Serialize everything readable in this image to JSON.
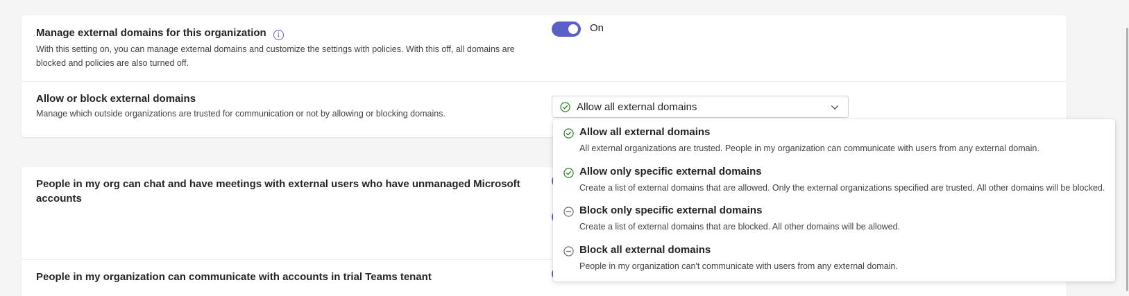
{
  "external_domains": {
    "manage_title": "Manage external domains for this organization",
    "manage_desc_line1": "With this setting on, you can manage external domains and customize the settings with policies. With this off, all domains are",
    "manage_desc_line2": "blocked and policies are also turned off.",
    "toggle_state": "On",
    "allow_block_title": "Allow or block external domains",
    "allow_block_desc": "Manage which outside organizations are trusted for communication or not by allowing or blocking domains.",
    "selected_value": "Allow all external domains"
  },
  "dropdown_options": [
    {
      "title": "Allow all external domains",
      "desc": "All external organizations are trusted. People in my organization can communicate with users from any external domain.",
      "icon": "check-circle-icon"
    },
    {
      "title": "Allow only specific external domains",
      "desc": "Create a list of external domains that are allowed. Only the external organizations specified are trusted. All other domains will be blocked.",
      "icon": "check-circle-icon"
    },
    {
      "title": "Block only specific external domains",
      "desc": "Create a list of external domains that are blocked. All other domains will be allowed.",
      "icon": "minus-circle-icon"
    },
    {
      "title": "Block all external domains",
      "desc": "People in my organization can't communicate with users from any external domain.",
      "icon": "minus-circle-icon"
    }
  ],
  "unmanaged": {
    "title_line1": "People in my org can chat and have meetings with external users who have unmanaged Microsoft",
    "title_line2": "accounts"
  },
  "trial": {
    "title": "People in my organization can communicate with accounts in trial Teams tenant"
  },
  "colors": {
    "accent": "#5b5fc7",
    "check_green": "#107c10",
    "minus_gray": "#616161"
  }
}
